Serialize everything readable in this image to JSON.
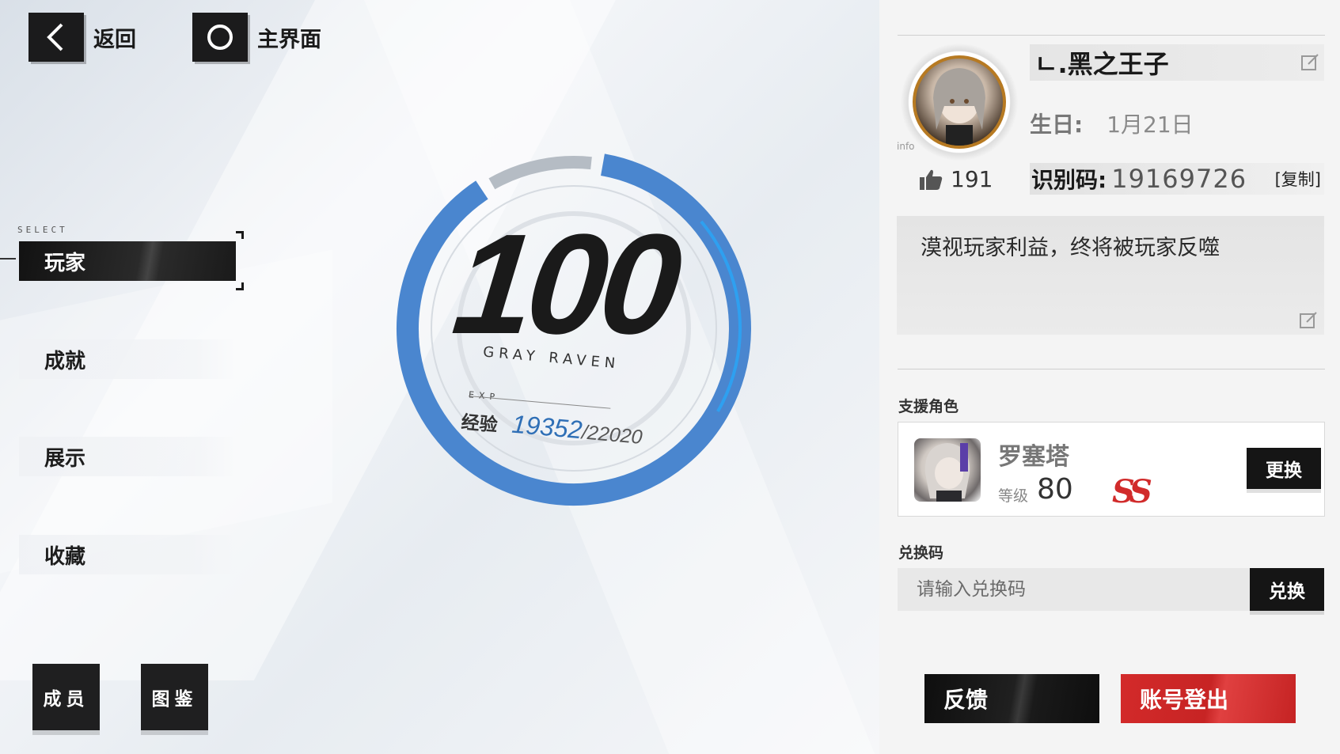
{
  "nav": {
    "back_label": "返回",
    "home_label": "主界面"
  },
  "sidebar": {
    "select_tag": "SELECT",
    "items": [
      {
        "label": "玩家",
        "active": true
      },
      {
        "label": "成就",
        "active": false
      },
      {
        "label": "展示",
        "active": false
      },
      {
        "label": "收藏",
        "active": false
      }
    ]
  },
  "bottom_buttons": {
    "members_label": "成员",
    "codex_label": "图鉴"
  },
  "level": {
    "value": "100",
    "team": "GRAY RAVEN",
    "exp_tag": "EXP",
    "exp_label": "经验",
    "exp_current": "19352",
    "exp_separator": "/",
    "exp_max": "22020",
    "exp_fraction": 0.879
  },
  "profile": {
    "info_tag": "info",
    "name": "ㄴ.黑之王子",
    "birthday_label": "生日:",
    "birthday_value": "1月21日",
    "likes": "191",
    "uid_label": "识别码:",
    "uid_value": "19169726",
    "copy_label": "[复制]",
    "signature": "漠视玩家利益，终将被玩家反噬"
  },
  "support": {
    "title": "支援角色",
    "character_name": "罗塞塔",
    "level_label": "等级",
    "level": "80",
    "rank": "SS",
    "change_label": "更换"
  },
  "redeem": {
    "title": "兑换码",
    "placeholder": "请输入兑换码",
    "button_label": "兑换"
  },
  "footer": {
    "feedback_label": "反馈",
    "logout_label": "账号登出"
  },
  "colors": {
    "gauge_blue": "#4a86cf",
    "gauge_gray": "#b5bcc4",
    "rank_red": "#d12b2b",
    "logout_red": "#d32a2a",
    "avatar_ring": "#b77a22"
  }
}
